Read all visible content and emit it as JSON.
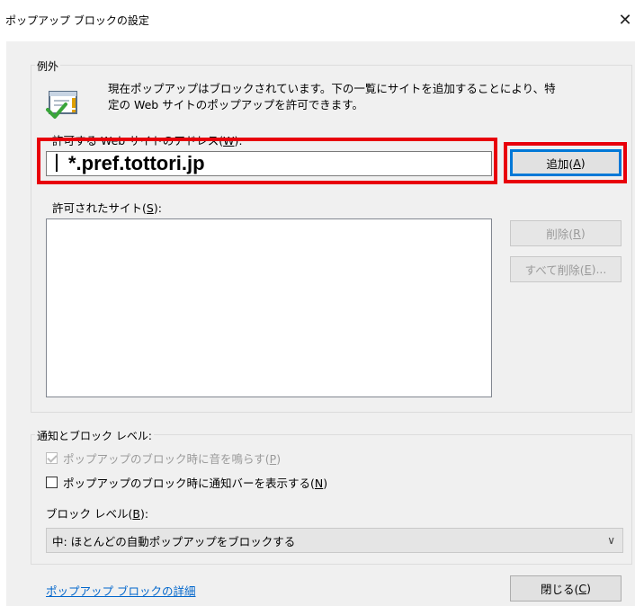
{
  "window": {
    "title": "ポップアップ ブロックの設定",
    "close_glyph": "✕"
  },
  "exceptions": {
    "legend": "例外",
    "description_line1": "現在ポップアップはブロックされています。下の一覧にサイトを追加することにより、特",
    "description_line2": "定の Web サイトのポップアップを許可できます。",
    "address_label_prefix": "許可する Web サイトのアドレス(",
    "address_label_key": "W",
    "address_label_suffix": "):",
    "address_value": "*.pref.tottori.jp",
    "add_prefix": "追加(",
    "add_key": "A",
    "add_suffix": ")",
    "allowed_label_prefix": "許可されたサイト(",
    "allowed_label_key": "S",
    "allowed_label_suffix": "):",
    "allowed_sites": [],
    "remove_prefix": "削除(",
    "remove_key": "R",
    "remove_suffix": ")",
    "remove_all_prefix": "すべて削除(",
    "remove_all_key": "E",
    "remove_all_suffix": ")..."
  },
  "notify": {
    "legend": "通知とブロック レベル:",
    "sound_prefix": "ポップアップのブロック時に音を鳴らす(",
    "sound_key": "P",
    "sound_suffix": ")",
    "sound_checked": true,
    "bar_prefix": "ポップアップのブロック時に通知バーを表示する(",
    "bar_key": "N",
    "bar_suffix": ")",
    "bar_checked": false,
    "level_label_prefix": "ブロック レベル(",
    "level_label_key": "B",
    "level_label_suffix": "):",
    "level_value": "中: ほとんどの自動ポップアップをブロックする"
  },
  "footer": {
    "details_link": "ポップアップ ブロックの詳細",
    "close_prefix": "閉じる(",
    "close_key": "C",
    "close_suffix": ")"
  },
  "colors": {
    "highlight": "#e8000b",
    "focus": "#0078d7",
    "link": "#0066cc"
  }
}
